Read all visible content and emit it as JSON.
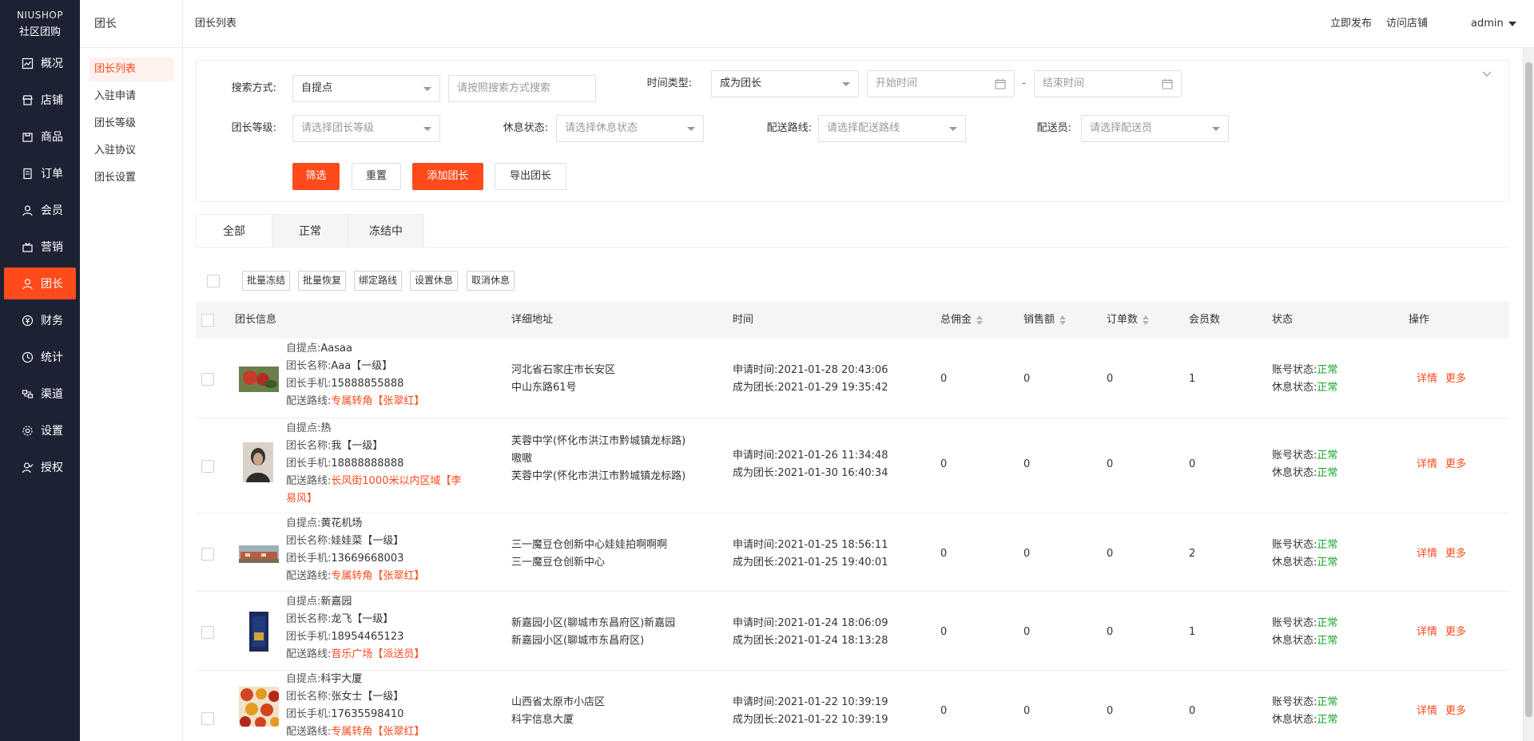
{
  "brand": {
    "top": "NIUSHOP",
    "bottom": "社区团购"
  },
  "sidenav": [
    {
      "label": "概况",
      "icon": "dashboard-icon"
    },
    {
      "label": "店铺",
      "icon": "store-icon"
    },
    {
      "label": "商品",
      "icon": "goods-icon"
    },
    {
      "label": "订单",
      "icon": "order-icon"
    },
    {
      "label": "会员",
      "icon": "member-icon"
    },
    {
      "label": "营销",
      "icon": "marketing-icon"
    },
    {
      "label": "团长",
      "icon": "leader-icon",
      "active": true
    },
    {
      "label": "财务",
      "icon": "finance-icon"
    },
    {
      "label": "统计",
      "icon": "stats-icon"
    },
    {
      "label": "渠道",
      "icon": "channel-icon"
    },
    {
      "label": "设置",
      "icon": "settings-icon"
    },
    {
      "label": "授权",
      "icon": "authorize-icon"
    }
  ],
  "subnav": {
    "title": "团长",
    "items": [
      "团长列表",
      "入驻申请",
      "团长等级",
      "入驻协议",
      "团长设置"
    ]
  },
  "header": {
    "breadcrumb": "团长列表",
    "publish": "立即发布",
    "visit_store": "访问店铺",
    "user": "admin"
  },
  "filter": {
    "search_mode_label": "搜索方式:",
    "search_mode_value": "自提点",
    "search_placeholder": "请按照搜索方式搜索",
    "time_type_label": "时间类型:",
    "time_type_value": "成为团长",
    "start_placeholder": "开始时间",
    "range_sep": "-",
    "end_placeholder": "结束时间",
    "level_label": "团长等级:",
    "level_placeholder": "请选择团长等级",
    "rest_label": "休息状态:",
    "rest_placeholder": "请选择休息状态",
    "route_label": "配送路线:",
    "route_placeholder": "请选择配送路线",
    "courier_label": "配送员:",
    "courier_placeholder": "请选择配送员",
    "btn_filter": "筛选",
    "btn_reset": "重置",
    "btn_add": "添加团长",
    "btn_export": "导出团长"
  },
  "tabs": [
    "全部",
    "正常",
    "冻结中"
  ],
  "batch": [
    "批量冻结",
    "批量恢复",
    "绑定路线",
    "设置休息",
    "取消休息"
  ],
  "columns": {
    "info": "团长信息",
    "address": "详细地址",
    "time": "时间",
    "commission": "总佣金",
    "sales": "销售额",
    "orders": "订单数",
    "members": "会员数",
    "status": "状态",
    "ops": "操作"
  },
  "labels": {
    "pickup": "自提点:",
    "name": "团长名称:",
    "phone": "团长手机:",
    "route": "配送路线:",
    "apply_time": "申请时间:",
    "become_time": "成为团长:",
    "account_status": "账号状态:",
    "rest_status": "休息状态:",
    "detail": "详情",
    "more": "更多"
  },
  "rows": [
    {
      "pickup": "Aasaa",
      "name": "Aaa【一级】",
      "phone": "15888855888",
      "route": "专属转角",
      "courier": "【张翠红】",
      "addr1": "河北省石家庄市长安区",
      "addr2": "中山东路61号",
      "apply": "2021-01-28 20:43:06",
      "become": "2021-01-29 19:35:42",
      "commission": "0",
      "sales": "0",
      "orders": "0",
      "members": "1",
      "account": "正常",
      "rest": "正常"
    },
    {
      "pickup": "热",
      "name": "我【一级】",
      "phone": "18888888888",
      "route": "长风街1000米以内区域",
      "courier": "【李易风】",
      "addr1": "芙蓉中学(怀化市洪江市黔城镇龙标路)嗷嗷",
      "addr2": "芙蓉中学(怀化市洪江市黔城镇龙标路)",
      "apply": "2021-01-26 11:34:48",
      "become": "2021-01-30 16:40:34",
      "commission": "0",
      "sales": "0",
      "orders": "0",
      "members": "0",
      "account": "正常",
      "rest": "正常"
    },
    {
      "pickup": "黄花机场",
      "name": "娃娃菜【一级】",
      "phone": "13669668003",
      "route": "专属转角",
      "courier": "【张翠红】",
      "addr1": "三一魔豆仓创新中心娃娃拍啊啊啊",
      "addr2": "三一魔豆仓创新中心",
      "apply": "2021-01-25 18:56:11",
      "become": "2021-01-25 19:40:01",
      "commission": "0",
      "sales": "0",
      "orders": "0",
      "members": "2",
      "account": "正常",
      "rest": "正常"
    },
    {
      "pickup": "新嘉园",
      "name": "龙飞【一级】",
      "phone": "18954465123",
      "route": "音乐广场",
      "courier": "【派送员】",
      "addr1": "新嘉园小区(聊城市东昌府区)新嘉园",
      "addr2": "新嘉园小区(聊城市东昌府区)",
      "apply": "2021-01-24 18:06:09",
      "become": "2021-01-24 18:13:28",
      "commission": "0",
      "sales": "0",
      "orders": "0",
      "members": "1",
      "account": "正常",
      "rest": "正常"
    },
    {
      "pickup": "科宇大厦",
      "name": "张女士【一级】",
      "phone": "17635598410",
      "route": "专属转角",
      "courier": "【张翠红】",
      "addr1": "山西省太原市小店区",
      "addr2": "科宇信息大厦",
      "apply": "2021-01-22 10:39:19",
      "become": "2021-01-22 10:39:19",
      "commission": "0",
      "sales": "0",
      "orders": "0",
      "members": "0",
      "account": "正常",
      "rest": "正常"
    }
  ],
  "colors": {
    "accent": "#ff4a1c",
    "sidebar": "#1c2233",
    "ok": "#16a52a"
  }
}
